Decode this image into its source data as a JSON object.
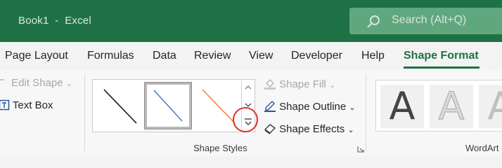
{
  "window": {
    "title": "Book1  -  Excel",
    "search_placeholder": "Search (Alt+Q)"
  },
  "tabs": [
    {
      "label": "Page Layout",
      "active": false
    },
    {
      "label": "Formulas",
      "active": false
    },
    {
      "label": "Data",
      "active": false
    },
    {
      "label": "Review",
      "active": false
    },
    {
      "label": "View",
      "active": false
    },
    {
      "label": "Developer",
      "active": false
    },
    {
      "label": "Help",
      "active": false
    },
    {
      "label": "Shape Format",
      "active": true
    }
  ],
  "insert_shapes": {
    "edit_shape": "Edit Shape",
    "text_box": "Text Box"
  },
  "shape_styles": {
    "group_label": "Shape Styles",
    "styles": [
      {
        "icon": "black-line-style"
      },
      {
        "icon": "blue-line-style",
        "selected": true
      },
      {
        "icon": "orange-line-style"
      }
    ],
    "shape_fill": "Shape Fill",
    "shape_outline": "Shape Outline",
    "shape_effects": "Shape Effects"
  },
  "wordart_styles": {
    "group_label": "WordArt",
    "sample_letter": "A"
  },
  "colors": {
    "accent": "#1e7145",
    "highlight_circle": "#e0302a"
  }
}
